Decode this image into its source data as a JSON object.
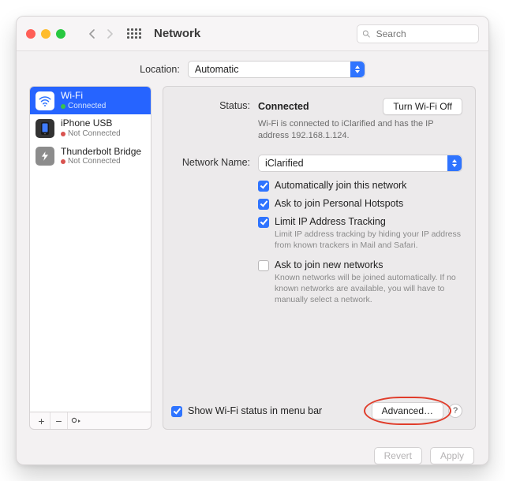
{
  "window": {
    "title": "Network"
  },
  "search": {
    "placeholder": "Search"
  },
  "location": {
    "label": "Location:",
    "value": "Automatic"
  },
  "sidebar": {
    "items": [
      {
        "name": "Wi-Fi",
        "status": "Connected"
      },
      {
        "name": "iPhone USB",
        "status": "Not Connected"
      },
      {
        "name": "Thunderbolt Bridge",
        "status": "Not Connected"
      }
    ]
  },
  "details": {
    "status_label": "Status:",
    "status_value": "Connected",
    "wifi_off_btn": "Turn Wi-Fi Off",
    "status_desc": "Wi-Fi is connected to iClarified and has the IP address 192.168.1.124.",
    "network_label": "Network Name:",
    "network_value": "iClarified",
    "chk_auto_join": "Automatically join this network",
    "chk_hotspots": "Ask to join Personal Hotspots",
    "chk_limit_ip": "Limit IP Address Tracking",
    "limit_ip_desc": "Limit IP address tracking by hiding your IP address from known trackers in Mail and Safari.",
    "chk_join_new": "Ask to join new networks",
    "join_new_desc": "Known networks will be joined automatically. If no known networks are available, you will have to manually select a network.",
    "chk_show_menu": "Show Wi-Fi status in menu bar",
    "advanced_btn": "Advanced…"
  },
  "footer": {
    "revert": "Revert",
    "apply": "Apply"
  }
}
